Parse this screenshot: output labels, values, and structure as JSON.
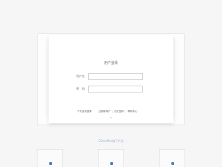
{
  "login": {
    "title": "用户登录",
    "username_label": "用户名",
    "username_value": "",
    "password_label": "密　码",
    "password_value": "",
    "remember_label": "下次自动登录",
    "link_register": "注册新用户",
    "link_forgot": "忘记密码",
    "link_help": "帮助中心"
  },
  "footer": {
    "caption": "CDiseMen旗下产品"
  },
  "colors": {
    "background": "#f6f6f6",
    "icon_accent": "#4b7fc4"
  }
}
